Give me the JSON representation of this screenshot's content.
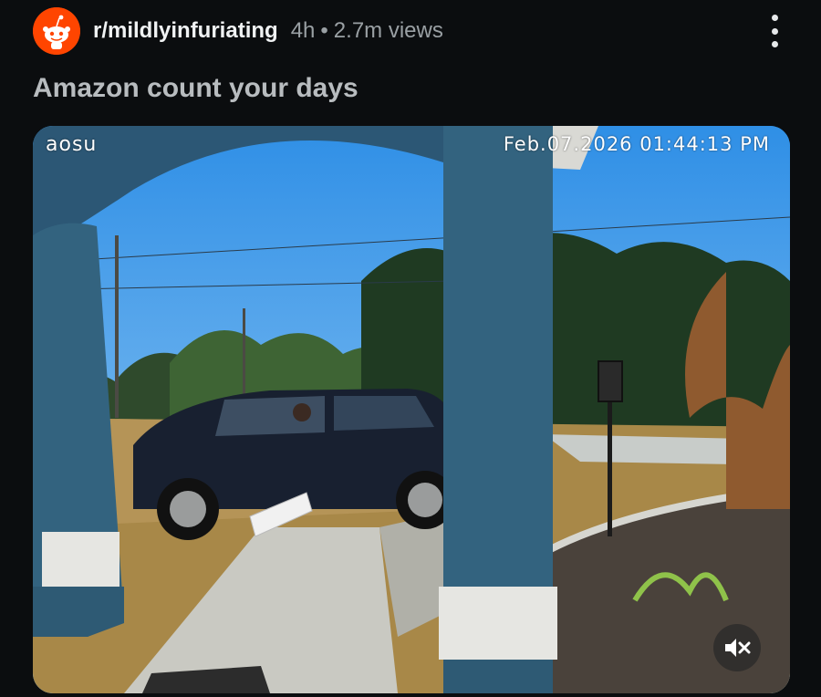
{
  "post": {
    "subreddit": "r/mildlyinfuriating",
    "age": "4h",
    "separator": "•",
    "views": "2.7m views",
    "title": "Amazon count your days"
  },
  "media": {
    "camera_brand": "aosu",
    "timestamp": "Feb.07.2026 01:44:13 PM"
  },
  "icons": {
    "avatar": "snoo-avatar",
    "more": "more-vertical-icon",
    "mute": "speaker-muted-icon"
  },
  "colors": {
    "background": "#0b0d0f",
    "avatar": "#ff4500",
    "title": "#b8bcbf",
    "meta": "#9aa0a4"
  }
}
